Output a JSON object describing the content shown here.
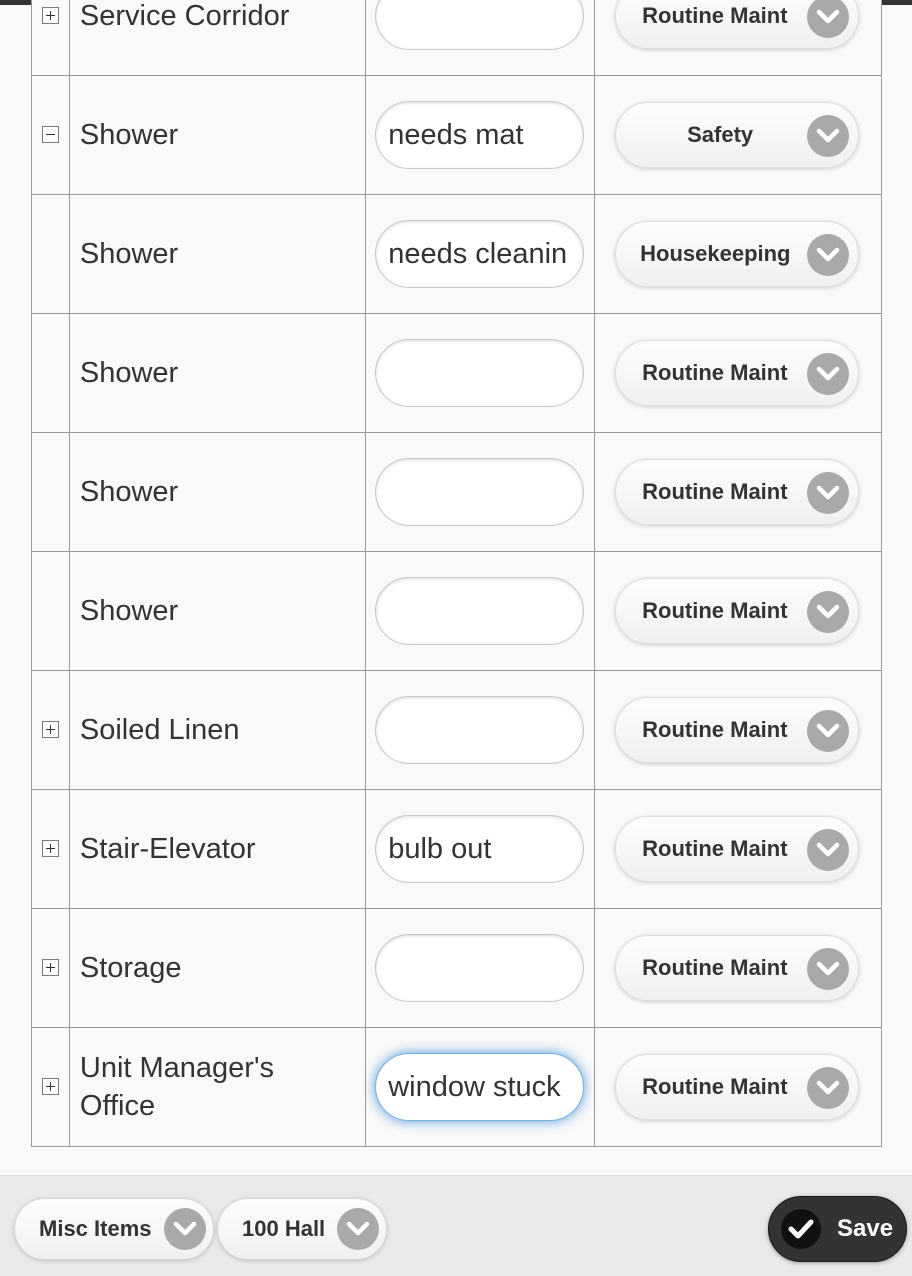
{
  "rows": [
    {
      "name": "Service Corridor",
      "expander": "plus",
      "note": "",
      "category": "Routine Maint"
    },
    {
      "name": "Shower",
      "expander": "minus",
      "note": "needs mat",
      "category": "Safety"
    },
    {
      "name": "Shower",
      "expander": "none",
      "note": "needs cleanin",
      "category": "Housekeeping"
    },
    {
      "name": "Shower",
      "expander": "none",
      "note": "",
      "category": "Routine Maint"
    },
    {
      "name": "Shower",
      "expander": "none",
      "note": "",
      "category": "Routine Maint"
    },
    {
      "name": "Shower",
      "expander": "none",
      "note": "",
      "category": "Routine Maint"
    },
    {
      "name": "Soiled Linen",
      "expander": "plus",
      "note": "",
      "category": "Routine Maint"
    },
    {
      "name": "Stair-Elevator",
      "expander": "plus",
      "note": "bulb out",
      "category": "Routine Maint"
    },
    {
      "name": "Storage",
      "expander": "plus",
      "note": "",
      "category": "Routine Maint"
    },
    {
      "name": "Unit Manager's Office",
      "expander": "plus",
      "note": "window stuck",
      "category": "Routine Maint"
    }
  ],
  "footer": {
    "type_select": "Misc Items",
    "location_select": "100 Hall",
    "save_label": "Save"
  },
  "colors": {
    "chevron_bg": "#a9a9a9",
    "save_bg": "#333333",
    "focus_glow": "#388cd7"
  },
  "icons": [
    "expand-icon",
    "collapse-icon",
    "chevron-down-icon",
    "checkmark-icon"
  ]
}
